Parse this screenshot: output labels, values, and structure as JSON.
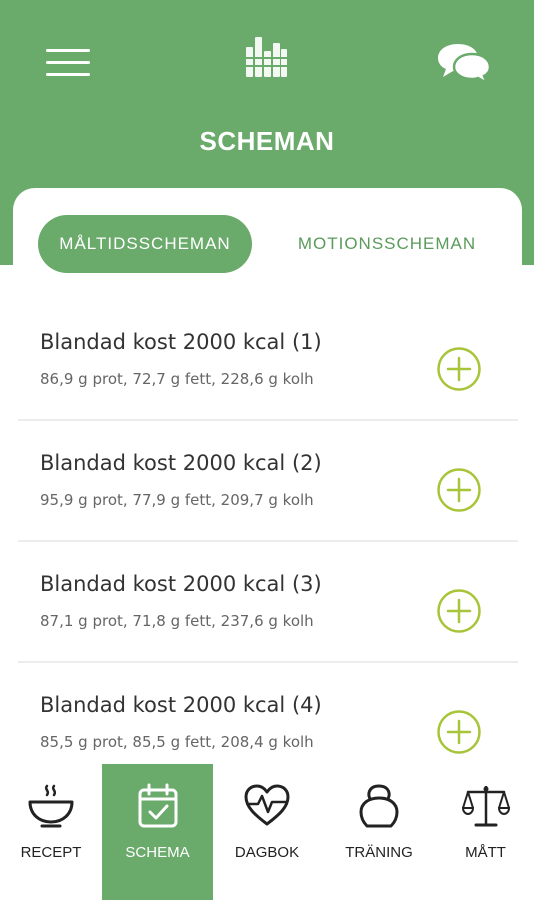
{
  "header": {
    "title": "SCHEMAN",
    "menu_icon": "menu-icon",
    "logo_icon": "app-logo-icon",
    "chat_icon": "chat-icon",
    "color": "#6aaa6b"
  },
  "tabs": [
    {
      "label": "MÅLTIDSSCHEMAN",
      "active": true
    },
    {
      "label": "MOTIONSSCHEMAN",
      "active": false
    }
  ],
  "plans": [
    {
      "title": "Blandad kost 2000 kcal (1)",
      "macros": "86,9 g prot, 72,7 g fett, 228,6 g kolh"
    },
    {
      "title": "Blandad kost 2000 kcal (2)",
      "macros": "95,9 g prot, 77,9 g fett, 209,7 g kolh"
    },
    {
      "title": "Blandad kost 2000 kcal (3)",
      "macros": "87,1 g prot, 71,8 g fett, 237,6 g kolh"
    },
    {
      "title": "Blandad kost 2000 kcal (4)",
      "macros": "85,5 g prot, 85,5 g fett, 208,4 g kolh"
    }
  ],
  "add_icon": "plus-circle-icon",
  "add_icon_color": "#a8c53a",
  "bottom_nav": [
    {
      "label": "RECEPT",
      "icon": "bowl-icon",
      "active": false
    },
    {
      "label": "SCHEMA",
      "icon": "calendar-icon",
      "active": true
    },
    {
      "label": "DAGBOK",
      "icon": "heartbeat-icon",
      "active": false
    },
    {
      "label": "TRÄNING",
      "icon": "kettlebell-icon",
      "active": false
    },
    {
      "label": "MÅTT",
      "icon": "scale-icon",
      "active": false
    }
  ]
}
